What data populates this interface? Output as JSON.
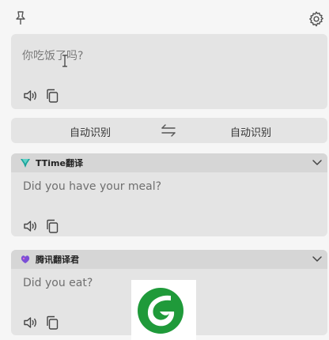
{
  "source": {
    "text": "你吃饭了吗?"
  },
  "languages": {
    "source": "自动识别",
    "target": "自动识别"
  },
  "results": [
    {
      "engine": "TTime翻译",
      "text": "Did you have your meal?"
    },
    {
      "engine": "腾讯翻译君",
      "text": "Did you eat?"
    }
  ],
  "icons": {
    "pin": "pin-icon",
    "settings": "gear-icon",
    "speak": "speaker-icon",
    "copy": "copy-icon",
    "swap": "swap-icon",
    "collapse": "chevron-down-icon"
  },
  "colors": {
    "card_bg": "#e4e4e4",
    "header_bg": "#d6d6d6",
    "ttime_logo": "#1aa39a",
    "tencent_logo": "#7b4fd6",
    "watermark_green": "#1f9a3a"
  }
}
